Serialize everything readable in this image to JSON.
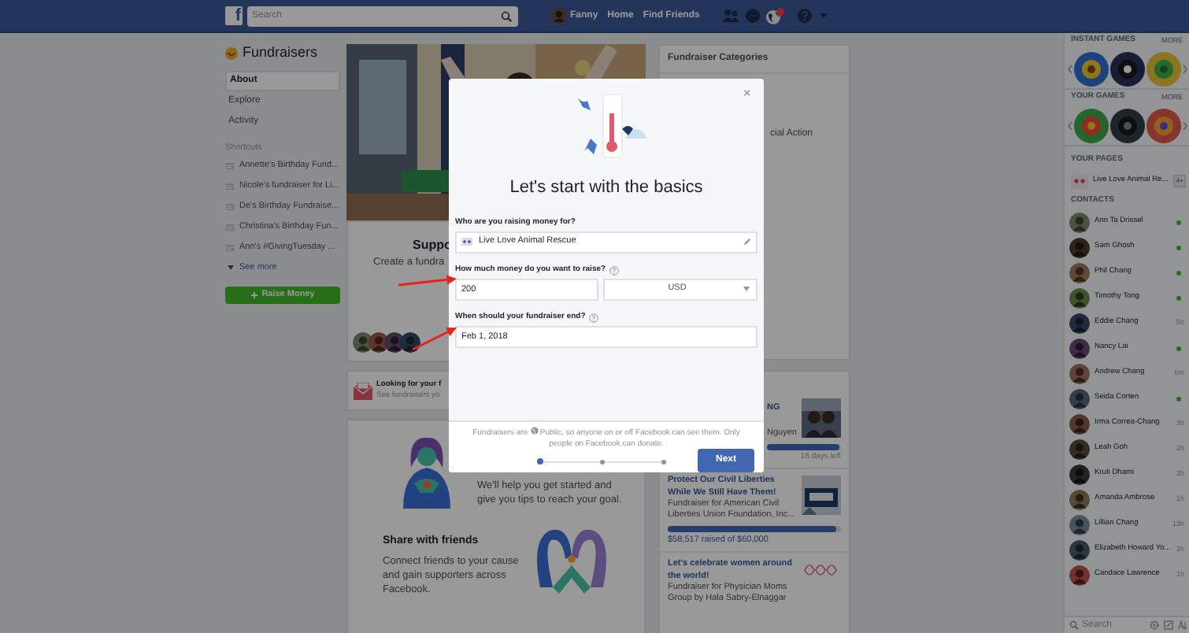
{
  "topbar": {
    "logo": "f",
    "search_placeholder": "Search",
    "user_name": "Fanny",
    "links": [
      "Home",
      "Find Friends"
    ]
  },
  "sidebar": {
    "title": "Fundraisers",
    "nav": [
      {
        "label": "About",
        "selected": true
      },
      {
        "label": "Explore",
        "selected": false
      },
      {
        "label": "Activity",
        "selected": false
      }
    ],
    "shortcuts_heading": "Shortcuts",
    "shortcuts": [
      "Annette's Birthday Fund...",
      "Nicole's fundraiser for Li...",
      "De's Birthday Fundraise...",
      "Christina's Birthday Fun...",
      "Ann's #GivingTuesday ..."
    ],
    "see_more": "See more",
    "raise_button": "Raise Money"
  },
  "center": {
    "support_heading": "Suppo",
    "support_text": "Create a fundra",
    "looking_title": "Looking for your f",
    "looking_text": "See fundraisers yo",
    "help_text": "We'll help you get started and give you tips to reach your goal.",
    "share_title": "Share with friends",
    "share_text": "Connect friends to your cause and gain supporters across Facebook."
  },
  "categories": {
    "title": "Fundraiser Categories",
    "visible_item": "cial Action"
  },
  "featured": [
    {
      "title": "NG",
      "subtitle": "Nguyen",
      "level": 0.98,
      "time_left": "16 days left"
    },
    {
      "title": "Protect Our Civil Liberties While We Still Have Them!",
      "subtitle": "Fundraiser for American Civil Liberties Union Foundation, Inc...",
      "level": 0.975,
      "raised": "$58,517 raised of $60,000"
    },
    {
      "kind": "logo",
      "title": "Let's celebrate women around the world!",
      "subtitle": "Fundraiser for Physician Moms Group by Hala Sabry-Elnaggar"
    }
  ],
  "modal": {
    "close": "×",
    "title": "Let's start with the basics",
    "fields": [
      {
        "kind": "picker",
        "label": "Who are you raising money for?",
        "help": false,
        "value": "Live Love Animal Rescue"
      },
      {
        "kind": "amount",
        "label": "How much money do you want to raise?",
        "help": true,
        "value": "200",
        "currency": "USD"
      },
      {
        "kind": "date",
        "label": "When should your fundraiser end?",
        "help": true,
        "value": "Feb 1, 2018"
      }
    ],
    "note_start": "Fundraisers are",
    "note_end": "Public, so anyone on or off Facebook can see them. Only people on Facebook can donate.",
    "steps": [
      {
        "selected": true
      },
      {
        "selected": false
      },
      {
        "selected": false
      }
    ],
    "next_button": "Next"
  },
  "chat": {
    "instant_games_heading": "INSTANT GAMES",
    "instant_games_more": "MORE",
    "your_games_heading": "YOUR GAMES",
    "your_games_more": "MORE",
    "pages_heading": "YOUR PAGES",
    "pages": [
      {
        "name": "Live Love Animal Re...",
        "badge": "4+"
      }
    ],
    "contacts_heading": "CONTACTS",
    "contacts": [
      {
        "name": "Ann Ta Drissel",
        "online": true
      },
      {
        "name": "Sam Ghosh",
        "online": true
      },
      {
        "name": "Phil Chang",
        "online": true
      },
      {
        "name": "Timothy Tong",
        "online": true
      },
      {
        "name": "Eddie Chang",
        "online": false,
        "last_active": "5h"
      },
      {
        "name": "Nancy Lai",
        "online": true
      },
      {
        "name": "Andrew Chang",
        "online": false,
        "last_active": "8m"
      },
      {
        "name": "Seida Corten",
        "online": true
      },
      {
        "name": "Irma Correa-Chang",
        "online": false,
        "last_active": "3h"
      },
      {
        "name": "Leah Goh",
        "online": false,
        "last_active": "2h"
      },
      {
        "name": "Kruti Dhami",
        "online": false,
        "last_active": "2h"
      },
      {
        "name": "Amanda Ambrose",
        "online": false,
        "last_active": "1h"
      },
      {
        "name": "Lillian Chang",
        "online": false,
        "last_active": "13h"
      },
      {
        "name": "Elizabeth Howard Yo...",
        "online": false,
        "last_active": "2h"
      },
      {
        "name": "Candace Lawrence",
        "online": false,
        "last_active": "1h"
      }
    ],
    "search_placeholder": "Search"
  }
}
